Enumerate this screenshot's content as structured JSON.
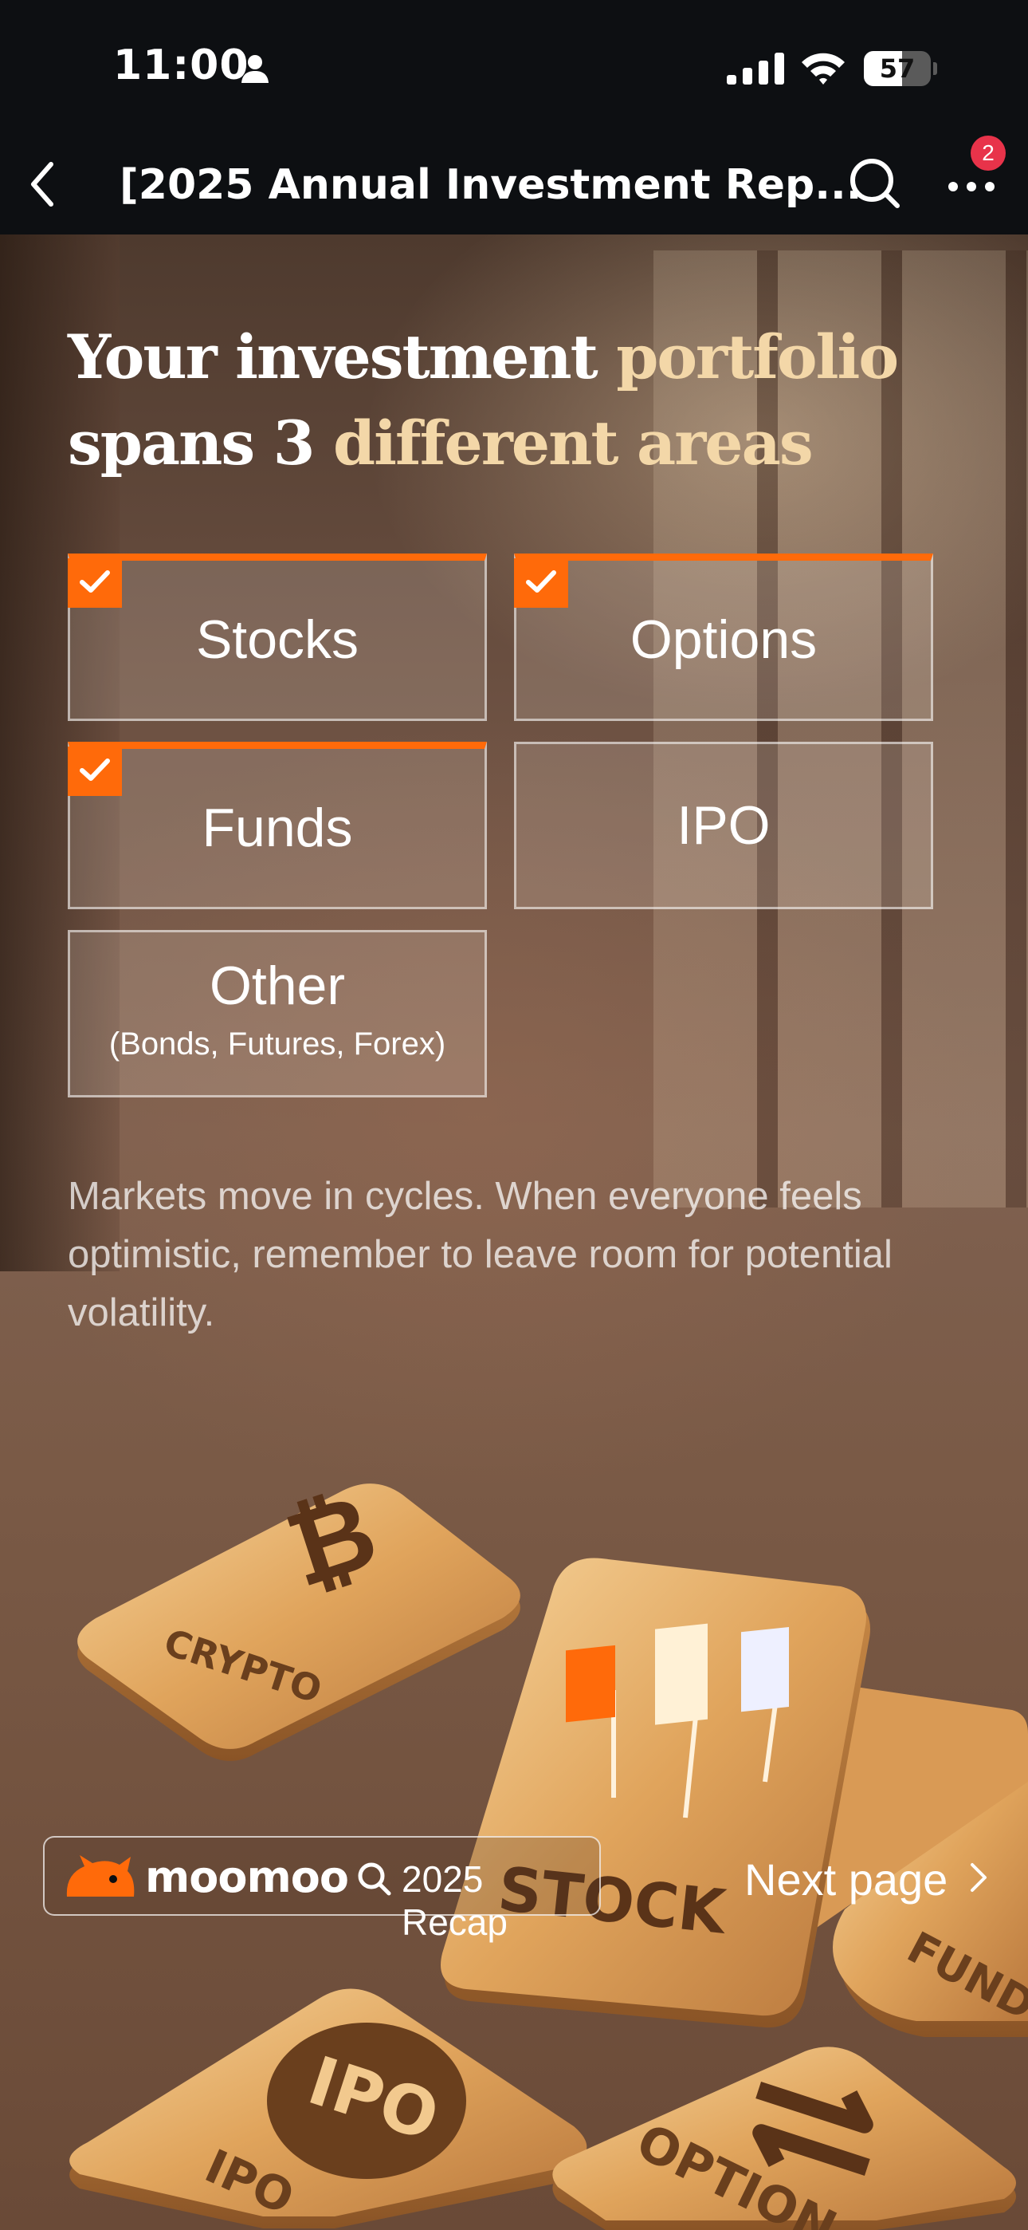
{
  "status_bar": {
    "time": "11:00",
    "battery": "57",
    "battery_level": 0.57
  },
  "nav": {
    "title": "[2025 Annual Investment Rep...",
    "badge_count": "2"
  },
  "headline": {
    "line1_white": "Your investment ",
    "line1_gold": "portfolio",
    "line2_white": "spans 3 ",
    "line2_gold": "different areas"
  },
  "categories": [
    {
      "label": "Stocks",
      "checked": true
    },
    {
      "label": "Options",
      "checked": true
    },
    {
      "label": "Funds",
      "checked": true
    },
    {
      "label": "IPO",
      "checked": false
    },
    {
      "label": "Other",
      "sub": "(Bonds, Futures, Forex)",
      "checked": false
    }
  ],
  "note": "Markets move in cycles. When everyone feels optimistic, remember to leave room for potential volatility.",
  "illustration": {
    "tiles": [
      "CRYPTO",
      "STOCK",
      "FUND",
      "IPO",
      "OPTION"
    ],
    "ipo_coin": "IPO"
  },
  "footer": {
    "brand": "moomoo",
    "recap": "2025 Recap",
    "next": "Next page"
  },
  "colors": {
    "accent": "#ff6a0a",
    "gold_text": "#f3d7a8",
    "badge": "#e8334a"
  },
  "icons": [
    "person-icon",
    "signal-icon",
    "wifi-icon",
    "back-icon",
    "search-icon",
    "more-icon",
    "check-icon",
    "bitcoin-icon",
    "candlestick-icon",
    "exchange-arrows-icon",
    "moomoo-logo-icon",
    "chevron-right-icon"
  ]
}
